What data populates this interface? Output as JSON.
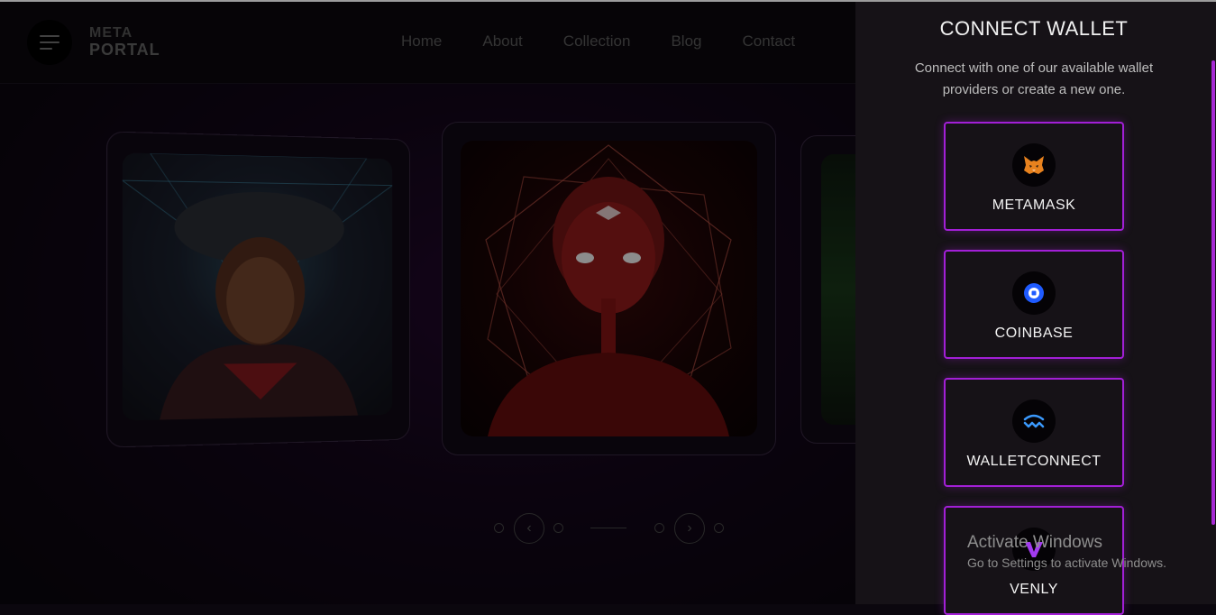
{
  "header": {
    "logo_line1": "META",
    "logo_line2": "PORTAL",
    "nav": [
      "Home",
      "About",
      "Collection",
      "Blog",
      "Contact"
    ]
  },
  "wallet_panel": {
    "title": "CONNECT WALLET",
    "description": "Connect with one of our available wallet providers or create a new one.",
    "providers": [
      {
        "label": "METAMASK",
        "icon": "metamask-fox-icon"
      },
      {
        "label": "COINBASE",
        "icon": "coinbase-icon"
      },
      {
        "label": "WALLETCONNECT",
        "icon": "walletconnect-icon"
      },
      {
        "label": "VENLY",
        "icon": "venly-icon"
      }
    ],
    "accent_color": "#a21fd6"
  },
  "watermark": {
    "title": "Activate Windows",
    "subtitle": "Go to Settings to activate Windows."
  }
}
